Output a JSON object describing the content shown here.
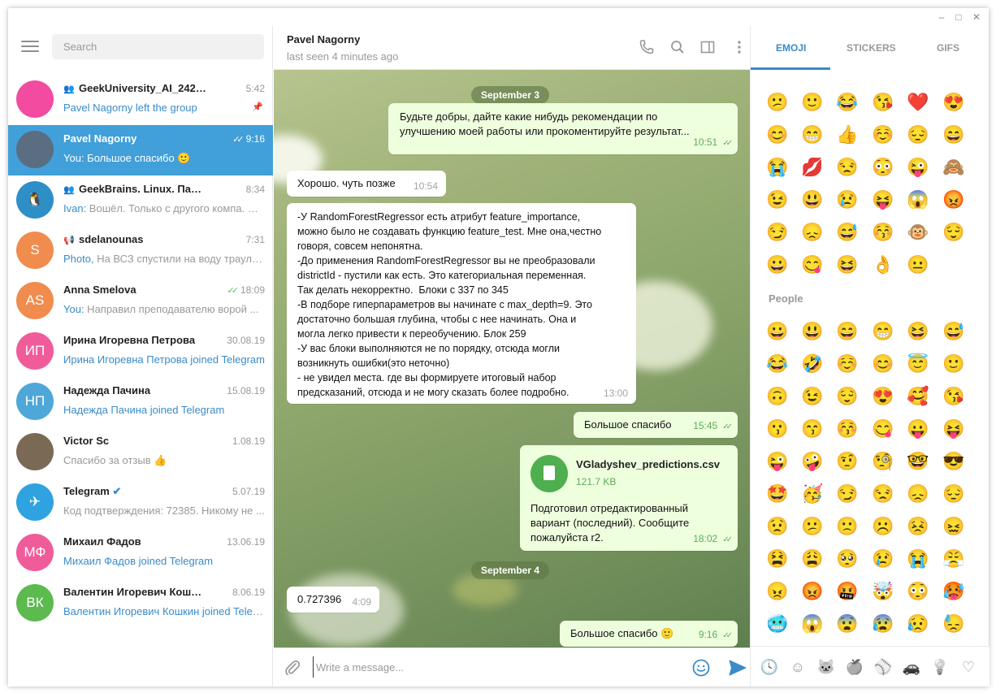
{
  "window": {
    "minimize": "–",
    "maximize": "□",
    "close": "✕"
  },
  "search": {
    "placeholder": "Search"
  },
  "chats": [
    {
      "name": "GeekUniversity_AI_242 (28.05....",
      "time": "5:42",
      "preview_prefix": "",
      "preview": "Pavel Nagorny left the group",
      "preview_blue": true,
      "group": true,
      "pinned": true,
      "avatar_text": "",
      "avatar_color": "#f24ba0",
      "active": false
    },
    {
      "name": "Pavel Nagorny",
      "time": "9:16",
      "preview_prefix": "You:",
      "preview": " Большое спасибо 🙂",
      "preview_blue": false,
      "group": false,
      "pinned": false,
      "avatar_text": "",
      "avatar_color": "#5b6d80",
      "active": true,
      "read": true
    },
    {
      "name": "GeekBrains. Linux. Павел Ст...",
      "time": "8:34",
      "preview_prefix": "Ivan:",
      "preview": " Вошёл. Только с другого компа. Но ...",
      "preview_blue": false,
      "group": true,
      "pinned": false,
      "avatar_text": "🐧",
      "avatar_color": "#2e8fc7",
      "active": false
    },
    {
      "name": "sdelanounas",
      "time": "7:31",
      "preview_prefix": "Photo,",
      "preview": " На ВСЗ спустили на воду траулер ...",
      "preview_blue": false,
      "channel": true,
      "pinned": false,
      "avatar_text": "S",
      "avatar_color": "#f08c4e",
      "active": false
    },
    {
      "name": "Anna Smelova",
      "time": "18:09",
      "preview_prefix": "You:",
      "preview": " Направил преподавателю ворой ...",
      "preview_blue": false,
      "pinned": false,
      "avatar_text": "AS",
      "avatar_color": "#f08c4e",
      "active": false,
      "read": true
    },
    {
      "name": "Ирина Игоревна Петрова",
      "time": "30.08.19",
      "preview_prefix": "",
      "preview": "Ирина Игоревна Петрова joined Telegram",
      "preview_blue": true,
      "pinned": false,
      "avatar_text": "ИП",
      "avatar_color": "#f05c9a",
      "active": false
    },
    {
      "name": "Надежда Пачина",
      "time": "15.08.19",
      "preview_prefix": "",
      "preview": "Надежда Пачина joined Telegram",
      "preview_blue": true,
      "pinned": false,
      "avatar_text": "НП",
      "avatar_color": "#4ea7d8",
      "active": false
    },
    {
      "name": "Victor Sc",
      "time": "1.08.19",
      "preview_prefix": "",
      "preview": "Спасибо за отзыв 👍",
      "preview_blue": false,
      "pinned": false,
      "avatar_text": "",
      "avatar_color": "#7a6a55",
      "active": false
    },
    {
      "name": "Telegram",
      "time": "5.07.19",
      "preview_prefix": "",
      "preview": "Код подтверждения: 72385. Никому не ...",
      "preview_blue": false,
      "verified": true,
      "pinned": false,
      "avatar_text": "✈",
      "avatar_color": "#2ea3e0",
      "active": false
    },
    {
      "name": "Михаил Фадов",
      "time": "13.06.19",
      "preview_prefix": "",
      "preview": "Михаил Фадов joined Telegram",
      "preview_blue": true,
      "pinned": false,
      "avatar_text": "МФ",
      "avatar_color": "#f05c9a",
      "active": false
    },
    {
      "name": "Валентин Игоревич Кошкин",
      "time": "8.06.19",
      "preview_prefix": "",
      "preview": "Валентин Игоревич Кошкин joined Telegram",
      "preview_blue": true,
      "pinned": false,
      "avatar_text": "ВК",
      "avatar_color": "#5cba4e",
      "active": false
    }
  ],
  "header": {
    "name": "Pavel Nagorny",
    "status": "last seen 4 minutes ago"
  },
  "dates": [
    "September 3",
    "September 4"
  ],
  "messages": [
    {
      "dir": "out",
      "text": "Будьте добры, дайте какие нибудь рекомендации по\nулучшению моей работы или прокоментируйте результат...",
      "time": "10:51"
    },
    {
      "dir": "in",
      "text": "Хорошо. чуть позже",
      "time": "10:54"
    },
    {
      "dir": "in",
      "text": "-У RandomForestRegressor есть атрибут feature_importance,\nможно было не создавать функцию feature_test. Мне она,честно\nговоря, совсем непонятна.\n-До применения RandomForestRegressor вы не преобразовали\ndistrictId - пустили как есть. Это категориальная переменная.\nТак делать некорректно.  Блоки с 337 по 345\n-В подборе гиперпараметров вы начинате с max_depth=9. Это\nдостаточно большая глубина, чтобы с нее начинать. Она и\nмогла легко привести к переобучению. Блок 259\n-У вас блоки выполняются не по порядку, отсюда могли\nвозникнуть ошибки(это неточно)\n- не увидел места. где вы формируете итоговый набор\nпредсказаний, отсюда и не могу сказать более подробно.",
      "time": "13:00"
    },
    {
      "dir": "out",
      "text": "Большое спасибо",
      "time": "15:45"
    },
    {
      "dir": "out",
      "file_name": "VGladyshev_predictions.csv",
      "file_size": "121.7 KB",
      "text": "Подготовил отредактированный\nвариант (последний). Сообщите\nпожалуйста r2.",
      "time": "18:02"
    },
    {
      "dir": "in",
      "text": "0.727396",
      "time": "4:09"
    },
    {
      "dir": "out",
      "text": "Большое спасибо 🙂",
      "time": "9:16"
    }
  ],
  "composer": {
    "placeholder": "Write a message..."
  },
  "emoji_tabs": [
    "EMOJI",
    "STICKERS",
    "GIFS"
  ],
  "recent_emoji": [
    "😕",
    "🙂",
    "😂",
    "😘",
    "❤️",
    "😍",
    "😊",
    "😁",
    "👍",
    "☺️",
    "😔",
    "😄",
    "😭",
    "💋",
    "😒",
    "😳",
    "😜",
    "🙈",
    "😉",
    "😃",
    "😢",
    "😝",
    "😱",
    "😡",
    "😏",
    "😞",
    "😅",
    "😚",
    "🐵",
    "😌",
    "😀",
    "😋",
    "😆",
    "👌",
    "😐"
  ],
  "people_label": "People",
  "people_emoji": [
    "😀",
    "😃",
    "😄",
    "😁",
    "😆",
    "😅",
    "😂",
    "🤣",
    "☺️",
    "😊",
    "😇",
    "🙂",
    "🙃",
    "😉",
    "😌",
    "😍",
    "🥰",
    "😘",
    "😗",
    "😙",
    "😚",
    "😋",
    "😛",
    "😝",
    "😜",
    "🤪",
    "🤨",
    "🧐",
    "🤓",
    "😎",
    "🤩",
    "🥳",
    "😏",
    "😒",
    "😞",
    "😔",
    "😟",
    "😕",
    "🙁",
    "☹️",
    "😣",
    "😖",
    "😫",
    "😩",
    "🥺",
    "😢",
    "😭",
    "😤",
    "😠",
    "😡",
    "🤬",
    "🤯",
    "😳",
    "🥵",
    "🥶",
    "😱",
    "😨",
    "😰",
    "😥",
    "😓"
  ],
  "categories": [
    "recent-icon",
    "smile-icon",
    "cat-icon",
    "apple-icon",
    "ball-icon",
    "car-icon",
    "bulb-icon",
    "heart-icon"
  ],
  "colors": {
    "accent": "#419fd9",
    "check": "#5ac265",
    "outgoing": "#eeffde"
  }
}
